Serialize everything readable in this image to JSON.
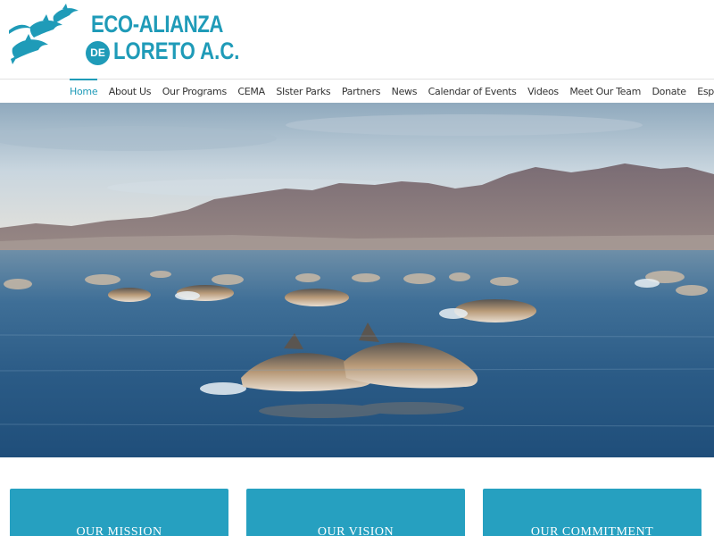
{
  "logo": {
    "line1": "ECO-ALIANZA",
    "de": "DE",
    "line2": "LORETO A.C.",
    "icon": "dolphins-logo-icon"
  },
  "nav": {
    "items": [
      {
        "label": "Home",
        "active": true
      },
      {
        "label": "About Us"
      },
      {
        "label": "Our Programs"
      },
      {
        "label": "CEMA"
      },
      {
        "label": "SIster Parks"
      },
      {
        "label": "Partners"
      },
      {
        "label": "News"
      },
      {
        "label": "Calendar of Events"
      },
      {
        "label": "Videos"
      },
      {
        "label": "Meet Our Team"
      },
      {
        "label": "Donate"
      },
      {
        "label": "Español"
      }
    ]
  },
  "hero": {
    "image": "dolphins-pod-hero-image"
  },
  "cards": [
    {
      "title": "OUR MISSION"
    },
    {
      "title": "OUR VISION"
    },
    {
      "title": "OUR COMMITMENT"
    }
  ],
  "colors": {
    "brand": "#1f9bb8",
    "card": "#26a0c0"
  }
}
